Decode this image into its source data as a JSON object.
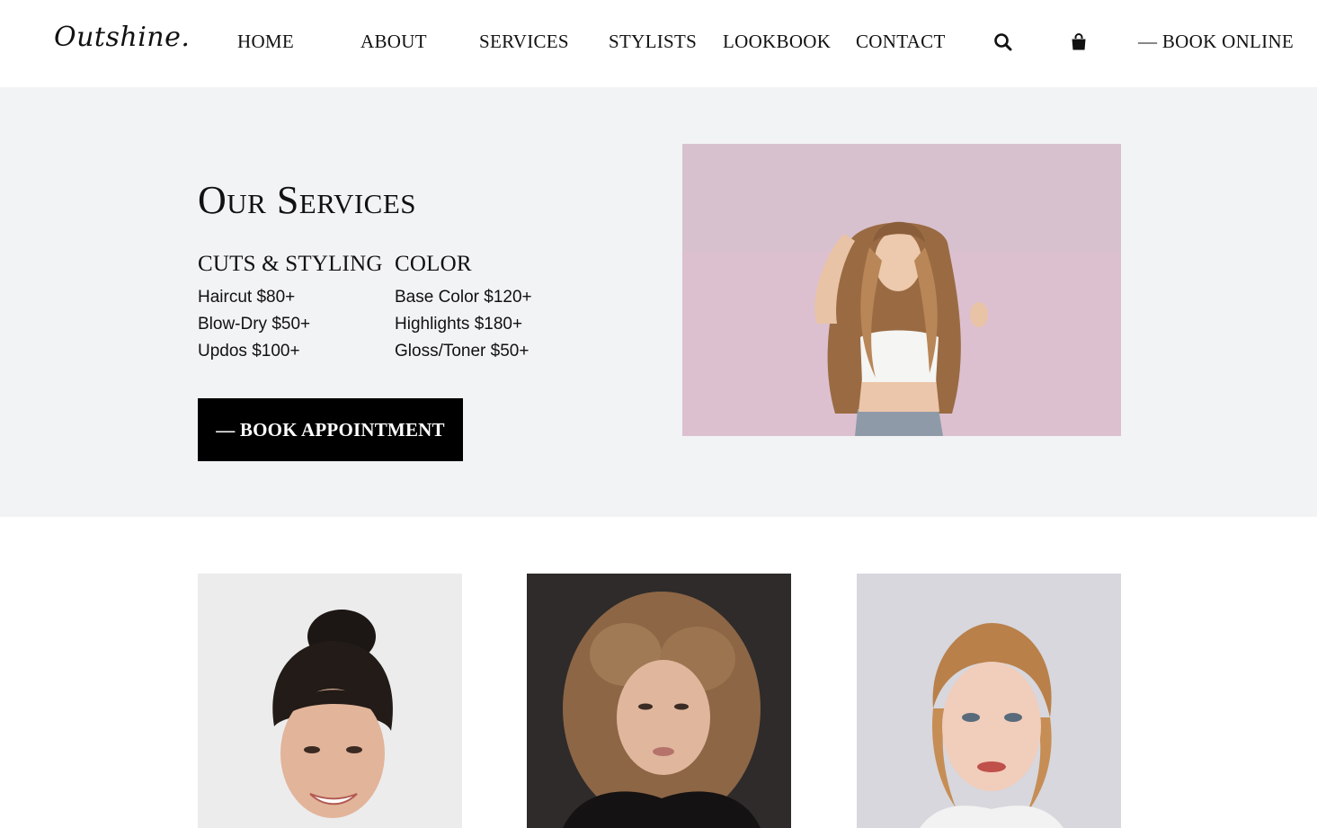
{
  "header": {
    "logo": "Outshine.",
    "nav": {
      "home": "HOME",
      "about": "ABOUT",
      "services": "SERVICES",
      "stylists": "STYLISTS",
      "lookbook": "LOOKBOOK",
      "contact": "CONTACT"
    },
    "icons": [
      "search-icon",
      "shopping-bag-icon"
    ],
    "book_online": "— BOOK ONLINE"
  },
  "services": {
    "title": "Our Services",
    "cuts": {
      "heading": "CUTS & STYLING",
      "items": [
        "Haircut $80+",
        "Blow-Dry $50+",
        "Updos $100+"
      ]
    },
    "color": {
      "heading": "COLOR",
      "items": [
        "Base Color $120+",
        "Highlights $180+",
        "Gloss/Toner $50+"
      ]
    },
    "button": "— BOOK APPOINTMENT"
  },
  "colors": {
    "band_background": "#f2f3f5",
    "button_background": "#000000",
    "hero_background": "#e4bcd0"
  }
}
